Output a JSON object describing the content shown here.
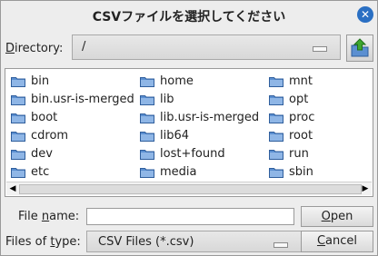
{
  "dialog": {
    "title": "CSVファイルを選択してください"
  },
  "directory": {
    "label_accel": "D",
    "label_rest": "irectory:",
    "value": "/"
  },
  "files": [
    {
      "name": "bin"
    },
    {
      "name": "bin.usr-is-merged"
    },
    {
      "name": "boot"
    },
    {
      "name": "cdrom"
    },
    {
      "name": "dev"
    },
    {
      "name": "etc"
    },
    {
      "name": "home"
    },
    {
      "name": "lib"
    },
    {
      "name": "lib.usr-is-merged"
    },
    {
      "name": "lib64"
    },
    {
      "name": "lost+found"
    },
    {
      "name": "media"
    },
    {
      "name": "mnt"
    },
    {
      "name": "opt"
    },
    {
      "name": "proc"
    },
    {
      "name": "root"
    },
    {
      "name": "run"
    },
    {
      "name": "sbin"
    }
  ],
  "file_name": {
    "label_pre": "File ",
    "label_accel": "n",
    "label_post": "ame:",
    "value": ""
  },
  "file_type": {
    "label_pre": "Files of ",
    "label_accel": "t",
    "label_post": "ype:",
    "value": "CSV Files (*.csv)"
  },
  "buttons": {
    "open_accel": "O",
    "open_rest": "pen",
    "cancel_accel": "C",
    "cancel_rest": "ancel"
  },
  "colors": {
    "folder": "#5b8fd1",
    "folder_tab": "#8fb6e6",
    "accent": "#2a6fc3",
    "up_arrow": "#3ea72f"
  }
}
